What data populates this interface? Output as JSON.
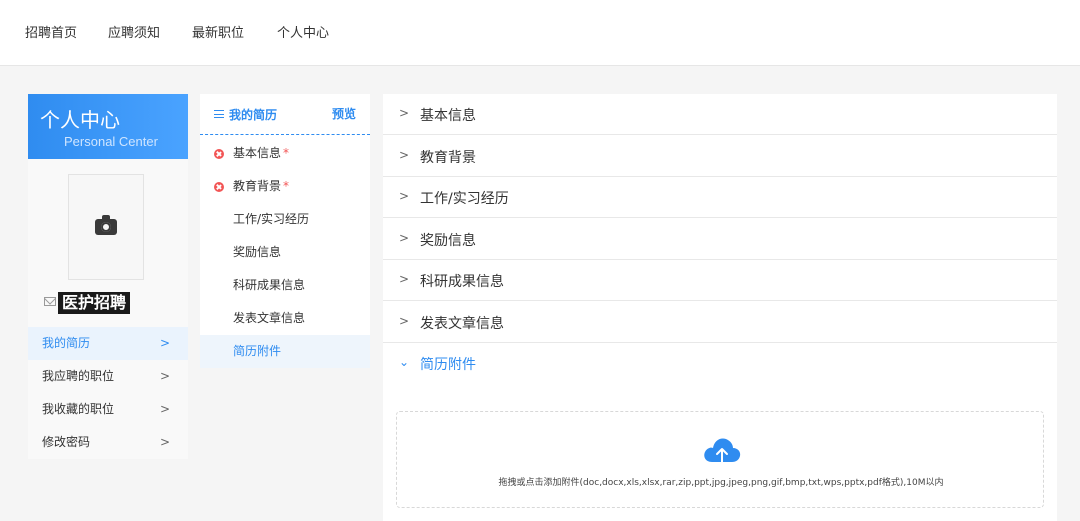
{
  "nav": {
    "items": [
      "招聘首页",
      "应聘须知",
      "最新职位",
      "个人中心"
    ]
  },
  "profile": {
    "title": "个人中心",
    "subtitle": "Personal Center",
    "org": "医护招聘",
    "menu": [
      {
        "label": "我的简历",
        "active": true
      },
      {
        "label": "我应聘的职位",
        "active": false
      },
      {
        "label": "我收藏的职位",
        "active": false
      },
      {
        "label": "修改密码",
        "active": false
      }
    ]
  },
  "resume": {
    "title": "我的简历",
    "preview": "预览",
    "sections": [
      {
        "label": "基本信息",
        "required": true,
        "error": true
      },
      {
        "label": "教育背景",
        "required": true,
        "error": true
      },
      {
        "label": "工作/实习经历",
        "required": false,
        "error": false
      },
      {
        "label": "奖励信息",
        "required": false,
        "error": false
      },
      {
        "label": "科研成果信息",
        "required": false,
        "error": false
      },
      {
        "label": "发表文章信息",
        "required": false,
        "error": false
      },
      {
        "label": "简历附件",
        "required": false,
        "error": false,
        "active": true
      }
    ],
    "required_mark": "*"
  },
  "accordion": {
    "items": [
      {
        "label": "基本信息",
        "open": false
      },
      {
        "label": "教育背景",
        "open": false
      },
      {
        "label": "工作/实习经历",
        "open": false
      },
      {
        "label": "奖励信息",
        "open": false
      },
      {
        "label": "科研成果信息",
        "open": false
      },
      {
        "label": "发表文章信息",
        "open": false
      },
      {
        "label": "简历附件",
        "open": true
      }
    ],
    "upload_hint": "拖拽或点击添加附件(doc,docx,xls,xlsx,rar,zip,ppt,jpg,jpeg,png,gif,bmp,txt,wps,pptx,pdf格式),10M以内"
  },
  "colors": {
    "accent": "#2f8cf0",
    "error": "#f25555",
    "header_bg": "#ffffff",
    "page_bg": "#f5f5f5"
  },
  "icons": {
    "camera": "camera-icon",
    "mail": "mail-icon",
    "list": "list-icon",
    "error": "error-icon",
    "chevron_right": "chevron-right-icon",
    "chevron_down": "chevron-down-icon",
    "upload": "cloud-upload-icon"
  }
}
